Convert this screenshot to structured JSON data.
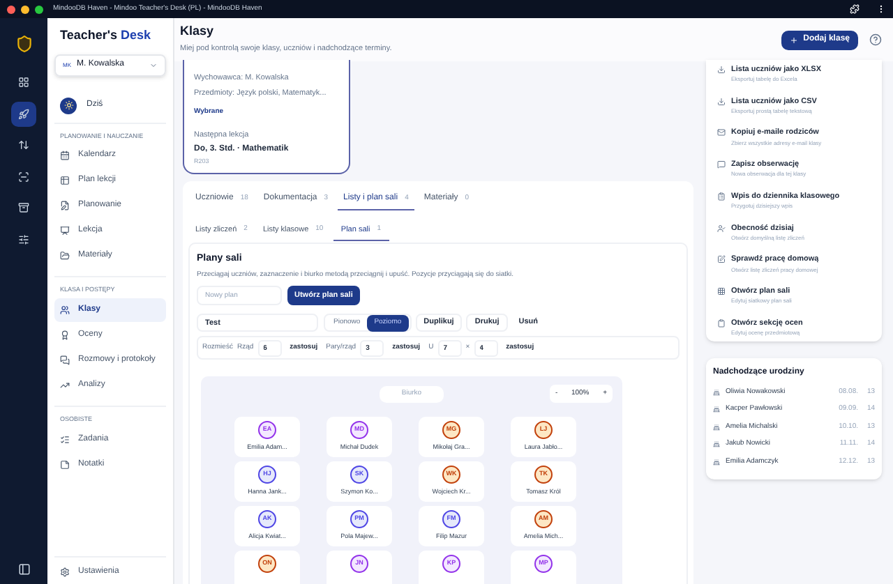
{
  "window": {
    "title": "MindooDB Haven - Mindoo Teacher's Desk (PL) - MindooDB Haven"
  },
  "rail": {
    "items": [
      {
        "selected": false
      },
      {
        "selected": true
      },
      {
        "selected": false
      },
      {
        "selected": false
      },
      {
        "selected": false
      },
      {
        "selected": false
      }
    ]
  },
  "sidebar": {
    "brand": {
      "first": "Teacher's",
      "second": "Desk"
    },
    "user": {
      "initials": "MK",
      "name": "M. Kowalska"
    },
    "today": "Dziś",
    "sections": [
      {
        "title": "PLANOWANIE I NAUCZANIE",
        "items": [
          {
            "label": "Kalendarz",
            "selected": false
          },
          {
            "label": "Plan lekcji",
            "selected": false
          },
          {
            "label": "Planowanie",
            "selected": false
          },
          {
            "label": "Lekcja",
            "selected": false
          },
          {
            "label": "Materiały",
            "selected": false
          }
        ]
      },
      {
        "title": "KLASA I POSTĘPY",
        "items": [
          {
            "label": "Klasy",
            "selected": true
          },
          {
            "label": "Oceny",
            "selected": false
          },
          {
            "label": "Rozmowy i protokoły",
            "selected": false
          },
          {
            "label": "Analizy",
            "selected": false
          }
        ]
      },
      {
        "title": "OSOBISTE",
        "items": [
          {
            "label": "Zadania",
            "selected": false
          },
          {
            "label": "Notatki",
            "selected": false
          }
        ]
      }
    ],
    "settings": "Ustawienia"
  },
  "header": {
    "title": "Klasy",
    "subtitle": "Miej pod kontrolą swoje klasy, uczniów i nadchodzące terminy.",
    "add_button": "Dodaj klasę"
  },
  "class_card": {
    "teacher": "Wychowawca: M. Kowalska",
    "subjects": "Przedmioty: Język polski, Matematyk...",
    "status": "Wybrane",
    "next_label": "Następna lekcja",
    "next_lesson": "Do, 3. Std. · Mathematik",
    "room": "R203"
  },
  "tabs": [
    {
      "label": "Uczniowie",
      "count": "18",
      "selected": false
    },
    {
      "label": "Dokumentacja",
      "count": "3",
      "selected": false
    },
    {
      "label": "Listy i plan sali",
      "count": "4",
      "selected": true
    },
    {
      "label": "Materiały",
      "count": "0",
      "selected": false
    }
  ],
  "subtabs": [
    {
      "label": "Listy zliczeń",
      "count": "2",
      "selected": false
    },
    {
      "label": "Listy klasowe",
      "count": "10",
      "selected": false
    },
    {
      "label": "Plan sali",
      "count": "1",
      "selected": true
    }
  ],
  "seating": {
    "title": "Plany sali",
    "description": "Przeciągaj uczniów, zaznaczenie i biurko metodą przeciągnij i upuść. Pozycje przyciągają się do siatki.",
    "new_plan": {
      "placeholder": "Nowy plan"
    },
    "create_button": "Utwórz plan sali",
    "plan_name": "Test",
    "orientation": [
      {
        "label": "Pionowo",
        "selected": false
      },
      {
        "label": "Poziomo",
        "selected": true
      }
    ],
    "actions": [
      "Duplikuj",
      "Drukuj",
      "Usuń"
    ],
    "arrange": {
      "label": "Rozmieść",
      "apply_row": "zastosuj",
      "apply_pairs": "zastosuj",
      "apply_u": "zastosuj",
      "row_label": "Rząd",
      "row_value": "6",
      "pairs_label": "Pary/rząd",
      "pairs_value": "3",
      "u_label": "U",
      "u_cols": "7",
      "times": "×",
      "u_rows": "4"
    },
    "canvas": {
      "desk": "Biurko",
      "zoom": "100%",
      "zoom_out": "-",
      "zoom_in": "+",
      "students": [
        {
          "initials": "EA",
          "name": "Emilia Adam...",
          "color": "#9333ea"
        },
        {
          "initials": "MD",
          "name": "Michał Dudek",
          "color": "#9333ea"
        },
        {
          "initials": "MG",
          "name": "Mikołaj Gra...",
          "color": "#c2410c"
        },
        {
          "initials": "LJ",
          "name": "Laura Jabło...",
          "color": "#c2410c"
        },
        {
          "initials": "HJ",
          "name": "Hanna Jank...",
          "color": "#4f46e5"
        },
        {
          "initials": "SK",
          "name": "Szymon Ko...",
          "color": "#4f46e5"
        },
        {
          "initials": "WK",
          "name": "Wojciech Kr...",
          "color": "#c2410c"
        },
        {
          "initials": "TK",
          "name": "Tomasz Król",
          "color": "#c2410c"
        },
        {
          "initials": "AK",
          "name": "Alicja Kwiat...",
          "color": "#4f46e5"
        },
        {
          "initials": "PM",
          "name": "Pola Majew...",
          "color": "#4f46e5"
        },
        {
          "initials": "FM",
          "name": "Filip Mazur",
          "color": "#4f46e5"
        },
        {
          "initials": "AM",
          "name": "Amelia Mich...",
          "color": "#c2410c"
        },
        {
          "initials": "ON",
          "color": "#c2410c"
        },
        {
          "initials": "JN",
          "color": "#9333ea"
        },
        {
          "initials": "KP",
          "color": "#9333ea"
        },
        {
          "initials": "MP",
          "color": "#9333ea"
        }
      ]
    }
  },
  "quick_actions": [
    {
      "title": "Lista uczniów jako XLSX",
      "subtitle": "Eksportuj tabelę do Excela"
    },
    {
      "title": "Lista uczniów jako CSV",
      "subtitle": "Eksportuj prostą tabelę tekstową"
    },
    {
      "title": "Kopiuj e-maile rodziców",
      "subtitle": "Zbierz wszystkie adresy e-mail klasy"
    },
    {
      "title": "Zapisz obserwację",
      "subtitle": "Nowa obserwacja dla tej klasy"
    },
    {
      "title": "Wpis do dziennika klasowego",
      "subtitle": "Przygotuj dzisiejszy wpis"
    },
    {
      "title": "Obecność dzisiaj",
      "subtitle": "Otwórz domyślną listę zliczeń"
    },
    {
      "title": "Sprawdź pracę domową",
      "subtitle": "Otwórz listę zliczeń pracy domowej"
    },
    {
      "title": "Otwórz plan sali",
      "subtitle": "Edytuj siatkowy plan sali"
    },
    {
      "title": "Otwórz sekcję ocen",
      "subtitle": "Edytuj ocenę przedmiotową"
    }
  ],
  "birthdays": {
    "title": "Nadchodzące urodziny",
    "items": [
      {
        "name": "Oliwia Nowakowski",
        "date": "08.08.",
        "age": "13"
      },
      {
        "name": "Kacper Pawłowski",
        "date": "09.09.",
        "age": "14"
      },
      {
        "name": "Amelia Michalski",
        "date": "10.10.",
        "age": "13"
      },
      {
        "name": "Jakub Nowicki",
        "date": "11.11.",
        "age": "14"
      },
      {
        "name": "Emilia Adamczyk",
        "date": "12.12.",
        "age": "13"
      }
    ]
  }
}
